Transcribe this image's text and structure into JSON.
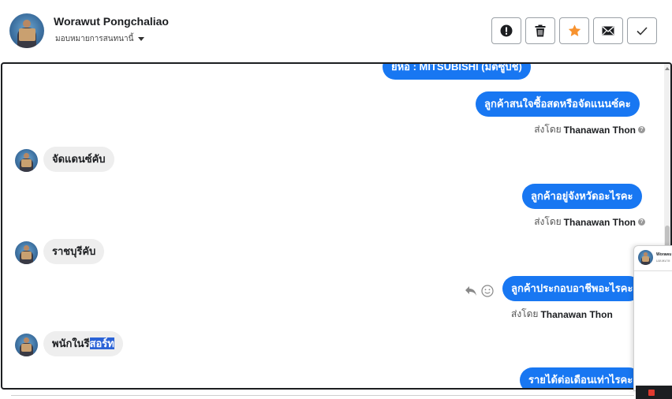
{
  "header": {
    "contact_name": "Worawut Pongchaliao",
    "assign_label": "มอบหมายการสนทนานี้"
  },
  "toolbar": {
    "icons": [
      "alert-icon",
      "trash-icon",
      "star-icon",
      "mail-icon",
      "check-icon"
    ],
    "star_color": "#f7922e"
  },
  "messages": {
    "m1": "ยี่ห้อ : MITSUBISHI (มิตซูบิชิ)",
    "m2": "ลูกค้าสนใจซื้อสดหรือจัดแนนซ์คะ",
    "m3": "จัดแดนซ์คับ",
    "m4": "ลูกค้าอยู่จังหวัดอะไรคะ",
    "m5": "ราชบุรีคับ",
    "m6": "ลูกค้าประกอบอาชีพอะไรคะ",
    "m7_plain": "พนักในรี",
    "m7_selected": "สอร์ท",
    "m8": "รายได้ต่อเดือนเท่าไรคะ"
  },
  "sent_by": {
    "prefix": "ส่งโดย",
    "agent": "Thanawan Thon",
    "help": "?"
  },
  "popout": {
    "name": "Worawu",
    "sub": "มอบหมาย"
  },
  "colors": {
    "outgoing_bubble": "#1877f2",
    "incoming_bubble": "#eeeeee",
    "selection": "#2b63d6"
  }
}
